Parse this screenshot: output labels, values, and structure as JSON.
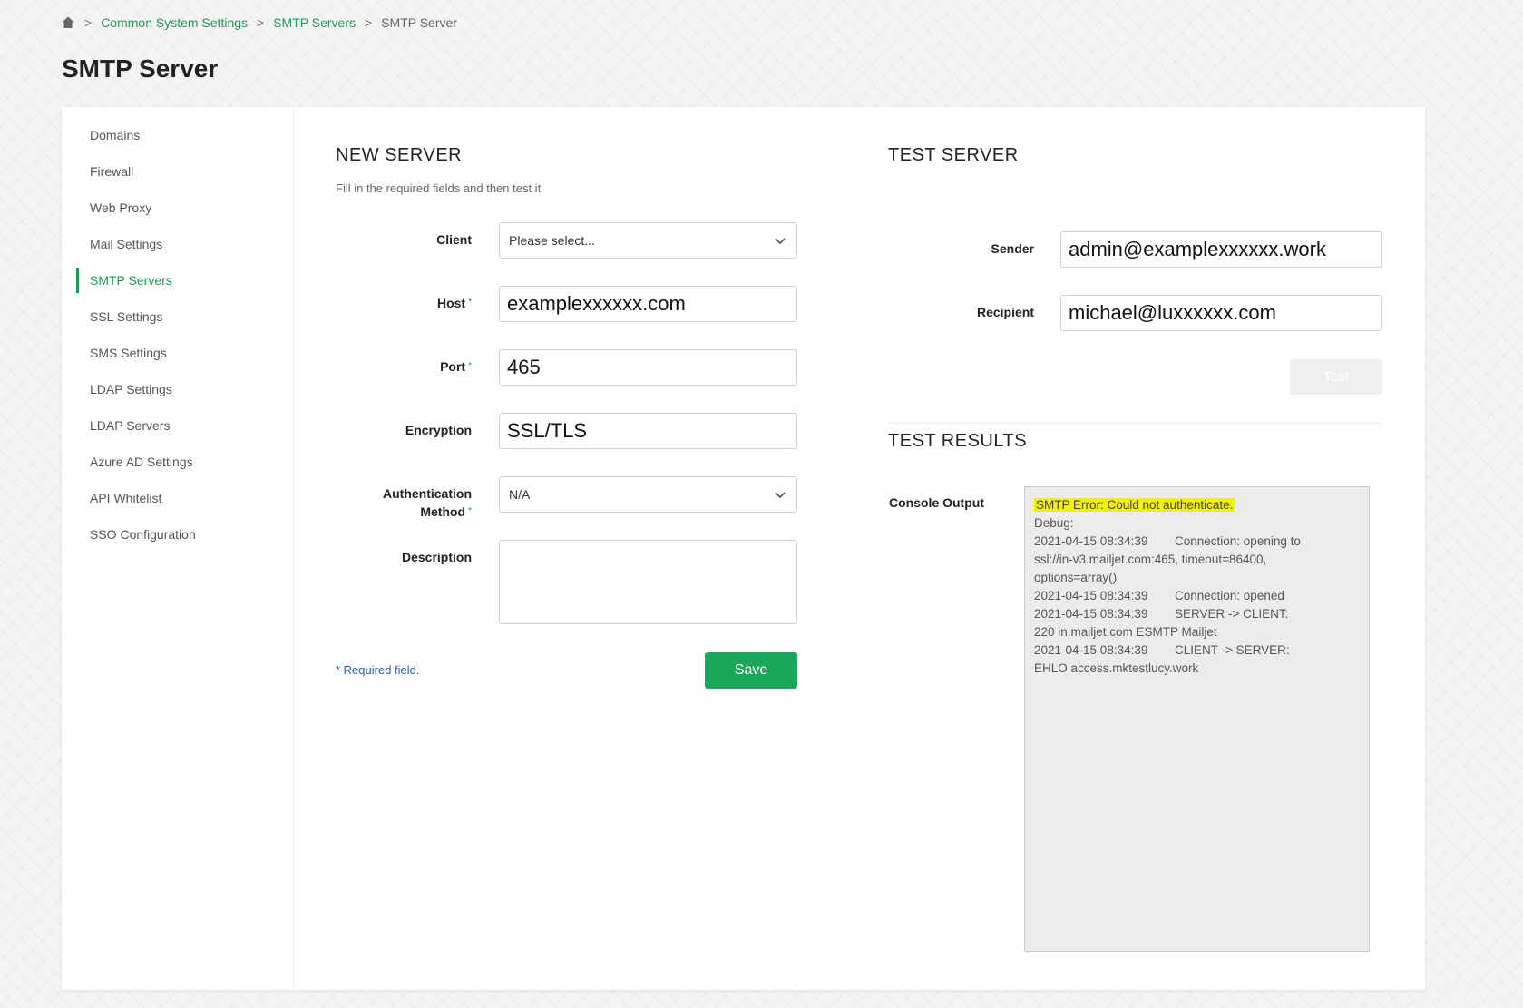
{
  "breadcrumb": {
    "items": [
      "Common System Settings",
      "SMTP Servers"
    ],
    "current": "SMTP Server",
    "separator": ">"
  },
  "page_title": "SMTP Server",
  "sidebar": {
    "items": [
      {
        "label": "Domains"
      },
      {
        "label": "Firewall"
      },
      {
        "label": "Web Proxy"
      },
      {
        "label": "Mail Settings"
      },
      {
        "label": "SMTP Servers",
        "active": true
      },
      {
        "label": "SSL Settings"
      },
      {
        "label": "SMS Settings"
      },
      {
        "label": "LDAP Settings"
      },
      {
        "label": "LDAP Servers"
      },
      {
        "label": "Azure AD Settings"
      },
      {
        "label": "API Whitelist"
      },
      {
        "label": "SSO Configuration"
      }
    ]
  },
  "new_server": {
    "title": "NEW SERVER",
    "hint": "Fill in the required fields and then test it",
    "client": {
      "label": "Client",
      "value": "Please select..."
    },
    "host": {
      "label": "Host",
      "value": "examplexxxxxx.com",
      "required_mark": "*"
    },
    "port": {
      "label": "Port",
      "value": "465",
      "required_mark": "*"
    },
    "encryption": {
      "label": "Encryption",
      "value": "SSL/TLS"
    },
    "auth_method": {
      "label_line1": "Authentication",
      "label_line2": "Method",
      "value": "N/A",
      "required_mark": "*"
    },
    "description": {
      "label": "Description",
      "value": ""
    },
    "required_note": "* Required field.",
    "save_label": "Save"
  },
  "test_server": {
    "title": "TEST SERVER",
    "sender": {
      "label": "Sender",
      "value": "admin@examplexxxxxx.work"
    },
    "recipient": {
      "label": "Recipient",
      "value": "michael@luxxxxxx.com"
    },
    "test_label": "Test"
  },
  "test_results": {
    "title": "TEST RESULTS",
    "console_label": "Console Output",
    "error_line": "SMTP Error: Could not authenticate.",
    "debug_line": "Debug:",
    "log": [
      {
        "ts": "2021-04-15 08:34:39",
        "msg": "Connection: opening to"
      },
      {
        "ts": "",
        "msg": "ssl://in-v3.mailjet.com:465, timeout=86400,"
      },
      {
        "ts": "",
        "msg": "options=array()"
      },
      {
        "ts": "2021-04-15 08:34:39",
        "msg": "Connection: opened"
      },
      {
        "ts": "2021-04-15 08:34:39",
        "msg": "SERVER -> CLIENT:"
      },
      {
        "ts": "",
        "msg": "220 in.mailjet.com ESMTP Mailjet"
      },
      {
        "ts": "2021-04-15 08:34:39",
        "msg": "CLIENT -> SERVER:"
      },
      {
        "ts": "",
        "msg": "EHLO access.mktestlucy.work"
      }
    ]
  },
  "colors": {
    "accent": "#1a9a52",
    "save_button": "#1aa85a",
    "highlight": "#f3f000"
  }
}
